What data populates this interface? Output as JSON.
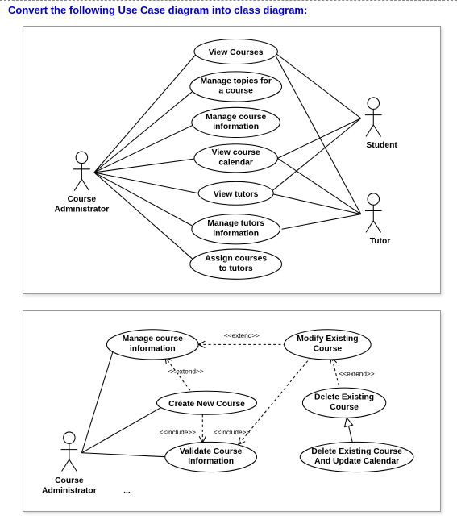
{
  "title": "Convert the following Use Case diagram into class diagram:",
  "diagram1": {
    "actors": {
      "courseAdmin": "Course\nAdministrator",
      "student": "Student",
      "tutor": "Tutor"
    },
    "usecases": {
      "viewCourses": "View Courses",
      "manageTopics": "Manage topics for\na course",
      "manageCourseInfo": "Manage course\ninformation",
      "viewCalendar": "View course\ncalendar",
      "viewTutors": "View tutors",
      "manageTutorsInfo": "Manage tutors\ninformation",
      "assignCourses": "Assign courses\nto tutors"
    }
  },
  "diagram2": {
    "actors": {
      "courseAdmin": "Course\nAdministrator"
    },
    "usecases": {
      "manageCourseInfo": "Manage course\ninformation",
      "modifyExisting": "Modify Existing\nCourse",
      "createNew": "Create New Course",
      "deleteExisting": "Delete Existing\nCourse",
      "validate": "Validate Course\nInformation",
      "deleteUpdate": "Delete Existing Course\nAnd Update Calendar"
    },
    "stereotypes": {
      "extend": "<<extend>>",
      "include": "<<include>>"
    }
  },
  "chart_data": [
    {
      "type": "usecase-diagram",
      "title": "Course System Use Cases (Top)",
      "actors": [
        "Course Administrator",
        "Student",
        "Tutor"
      ],
      "usecases": [
        "View Courses",
        "Manage topics for a course",
        "Manage course information",
        "View course calendar",
        "View tutors",
        "Manage tutors information",
        "Assign courses to tutors"
      ],
      "associations": [
        {
          "actor": "Course Administrator",
          "usecase": "View Courses"
        },
        {
          "actor": "Course Administrator",
          "usecase": "Manage topics for a course"
        },
        {
          "actor": "Course Administrator",
          "usecase": "Manage course information"
        },
        {
          "actor": "Course Administrator",
          "usecase": "View course calendar"
        },
        {
          "actor": "Course Administrator",
          "usecase": "View tutors"
        },
        {
          "actor": "Course Administrator",
          "usecase": "Manage tutors information"
        },
        {
          "actor": "Course Administrator",
          "usecase": "Assign courses to tutors"
        },
        {
          "actor": "Student",
          "usecase": "View Courses"
        },
        {
          "actor": "Student",
          "usecase": "View course calendar"
        },
        {
          "actor": "Student",
          "usecase": "View tutors"
        },
        {
          "actor": "Tutor",
          "usecase": "View Courses"
        },
        {
          "actor": "Tutor",
          "usecase": "View course calendar"
        },
        {
          "actor": "Tutor",
          "usecase": "View tutors"
        },
        {
          "actor": "Tutor",
          "usecase": "Manage tutors information"
        }
      ]
    },
    {
      "type": "usecase-diagram",
      "title": "Manage Course Information Detail (Bottom)",
      "actors": [
        "Course Administrator"
      ],
      "usecases": [
        "Manage course information",
        "Modify Existing Course",
        "Create New Course",
        "Delete Existing Course",
        "Validate Course Information",
        "Delete Existing Course And Update Calendar"
      ],
      "associations": [
        {
          "actor": "Course Administrator",
          "usecase": "Manage course information"
        },
        {
          "actor": "Course Administrator",
          "usecase": "Create New Course"
        },
        {
          "actor": "Course Administrator",
          "usecase": "Validate Course Information"
        }
      ],
      "extends": [
        {
          "from": "Modify Existing Course",
          "to": "Manage course information"
        },
        {
          "from": "Create New Course",
          "to": "Manage course information"
        },
        {
          "from": "Delete Existing Course",
          "to": "Modify Existing Course"
        },
        {
          "from": "Delete Existing Course And Update Calendar",
          "to": "Delete Existing Course"
        }
      ],
      "includes": [
        {
          "from": "Create New Course",
          "to": "Validate Course Information"
        },
        {
          "from": "Modify Existing Course",
          "to": "Validate Course Information"
        }
      ]
    }
  ]
}
